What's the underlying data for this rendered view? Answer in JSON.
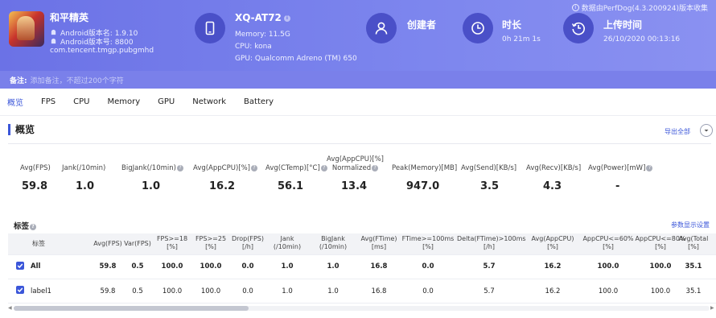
{
  "app": {
    "name": "和平精英",
    "android_version": "Android版本名: 1.9.10",
    "android_code": "Android版本号: 8800",
    "package": "com.tencent.tmgp.pubgmhd"
  },
  "device": {
    "title": "XQ-AT72",
    "info_badge": "i",
    "memory": "Memory: 11.5G",
    "cpu": "CPU: kona",
    "gpu": "GPU: Qualcomm Adreno (TM) 650"
  },
  "creator": {
    "title": "创建者"
  },
  "duration": {
    "title": "时长",
    "value": "0h 21m 1s"
  },
  "upload": {
    "title": "上传时间",
    "value": "26/10/2020 00:13:16"
  },
  "data_source": "数据由PerfDog(4.3.200924)版本收集",
  "note": {
    "label": "备注:",
    "placeholder": "添加备注，不超过200个字符"
  },
  "tabs": [
    "概览",
    "FPS",
    "CPU",
    "Memory",
    "GPU",
    "Network",
    "Battery"
  ],
  "overview": {
    "title": "概览",
    "export_label": "导出全部",
    "stats": [
      {
        "label": "Avg(FPS)",
        "value": "59.8"
      },
      {
        "label": "Jank(/10min)",
        "value": "1.0"
      },
      {
        "label": "BigJank(/10min)",
        "value": "1.0"
      },
      {
        "label": "Avg(AppCPU)[%]",
        "value": "16.2"
      },
      {
        "label": "Avg(CTemp)[°C]",
        "value": "56.1"
      },
      {
        "label": "Avg(AppCPU)[%]",
        "label2": "Normalized",
        "value": "13.4"
      },
      {
        "label": "Peak(Memory)[MB]",
        "value": "947.0"
      },
      {
        "label": "Avg(Send)[KB/s]",
        "value": "3.5"
      },
      {
        "label": "Avg(Recv)[KB/s]",
        "value": "4.3"
      },
      {
        "label": "Avg(Power)[mW]",
        "value": "-"
      }
    ]
  },
  "tags": {
    "title": "标签",
    "settings_label": "参数显示设置",
    "columns": [
      {
        "l1": "标签",
        "l2": ""
      },
      {
        "l1": "Avg(FPS)",
        "l2": ""
      },
      {
        "l1": "Var(FPS)",
        "l2": ""
      },
      {
        "l1": "FPS>=18",
        "l2": "[%]"
      },
      {
        "l1": "FPS>=25",
        "l2": "[%]"
      },
      {
        "l1": "Drop(FPS)",
        "l2": "[/h]"
      },
      {
        "l1": "Jank",
        "l2": "(/10min)"
      },
      {
        "l1": "BigJank",
        "l2": "(/10min)"
      },
      {
        "l1": "Avg(FTime)",
        "l2": "[ms]"
      },
      {
        "l1": "FTime>=100ms",
        "l2": "[%]"
      },
      {
        "l1": "Delta(FTime)>100ms",
        "l2": "[/h]"
      },
      {
        "l1": "Avg(AppCPU)",
        "l2": "[%]"
      },
      {
        "l1": "AppCPU<=60%",
        "l2": "[%]"
      },
      {
        "l1": "AppCPU<=80%",
        "l2": "[%]"
      },
      {
        "l1": "Avg(Total",
        "l2": "[%]"
      }
    ],
    "rows": [
      {
        "name": "All",
        "values": [
          "59.8",
          "0.5",
          "100.0",
          "100.0",
          "0.0",
          "1.0",
          "1.0",
          "16.8",
          "0.0",
          "5.7",
          "16.2",
          "100.0",
          "100.0",
          "35.1"
        ]
      },
      {
        "name": "label1",
        "values": [
          "59.8",
          "0.5",
          "100.0",
          "100.0",
          "0.0",
          "1.0",
          "1.0",
          "16.8",
          "0.0",
          "5.7",
          "16.2",
          "100.0",
          "100.0",
          "35.1"
        ]
      }
    ]
  }
}
